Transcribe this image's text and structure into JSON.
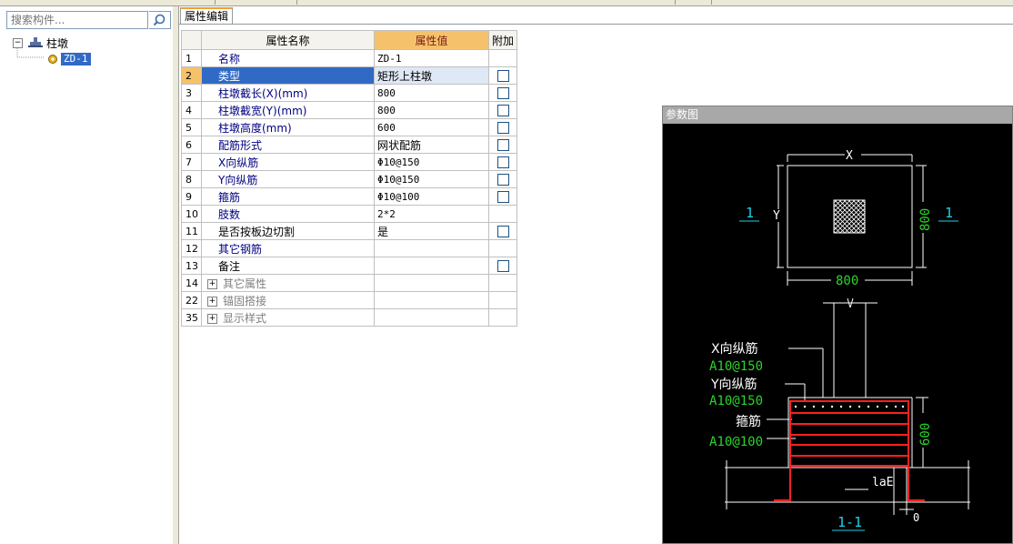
{
  "left_panel": {
    "search": {
      "placeholder": "搜索构件..."
    },
    "tree": {
      "root_label": "柱墩",
      "root_expander": "−",
      "child_label": "ZD-1"
    }
  },
  "tab": {
    "label": "属性编辑"
  },
  "grid": {
    "headers": {
      "name": "属性名称",
      "value": "属性值",
      "extra": "附加"
    },
    "rows": [
      {
        "num": "1",
        "name": "名称",
        "value": "ZD-1"
      },
      {
        "num": "2",
        "name": "类型",
        "value": "矩形上柱墩"
      },
      {
        "num": "3",
        "name": "柱墩截长(X)(mm)",
        "value": "800"
      },
      {
        "num": "4",
        "name": "柱墩截宽(Y)(mm)",
        "value": "800"
      },
      {
        "num": "5",
        "name": "柱墩高度(mm)",
        "value": "600"
      },
      {
        "num": "6",
        "name": "配筋形式",
        "value": "网状配筋"
      },
      {
        "num": "7",
        "name": "X向纵筋",
        "value": "Φ10@150"
      },
      {
        "num": "8",
        "name": "Y向纵筋",
        "value": "Φ10@150"
      },
      {
        "num": "9",
        "name": "箍筋",
        "value": "Φ10@100"
      },
      {
        "num": "10",
        "name": "肢数",
        "value": "2*2"
      },
      {
        "num": "11",
        "name": "是否按板边切割",
        "value": "是"
      },
      {
        "num": "12",
        "name": "其它钢筋",
        "value": ""
      },
      {
        "num": "13",
        "name": "备注",
        "value": ""
      },
      {
        "num": "14",
        "name": "其它属性",
        "value": ""
      },
      {
        "num": "22",
        "name": "锚固搭接",
        "value": ""
      },
      {
        "num": "35",
        "name": "显示样式",
        "value": ""
      }
    ]
  },
  "diagram": {
    "title": "参数图",
    "labels": {
      "x": "X",
      "y": "Y",
      "dim_bottom": "800",
      "dim_right": "800",
      "section_left": "1",
      "section_right": "1",
      "x_bar": "X向纵筋",
      "x_bar_spec": "A10@150",
      "y_bar": "Y向纵筋",
      "y_bar_spec": "A10@150",
      "stirrup": "箍筋",
      "stirrup_spec": "A10@100",
      "height": "600",
      "lae": "laE",
      "zero": "0",
      "section_name": "1-1"
    },
    "colors": {
      "white": "#ffffff",
      "green": "#2ad42a",
      "cyan": "#21d0e6",
      "red": "#ff2020"
    }
  }
}
